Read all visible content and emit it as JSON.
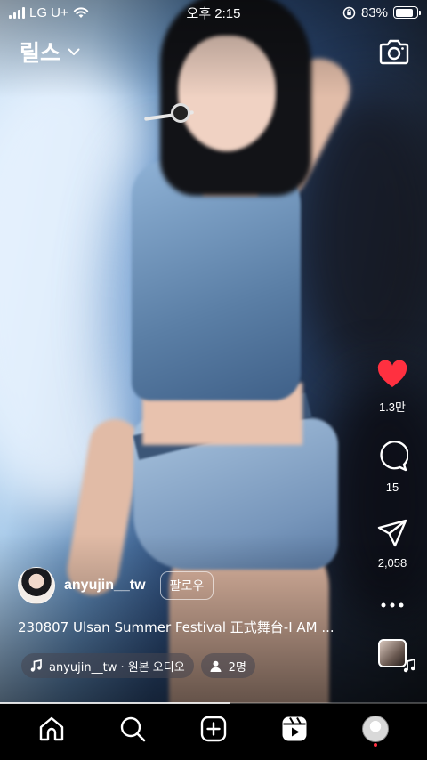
{
  "status_bar": {
    "carrier": "LG U+",
    "time": "오후 2:15",
    "battery_percent": "83%",
    "battery_level": 0.83
  },
  "header": {
    "title": "릴스",
    "dropdown_icon": "chevron-down-icon",
    "camera_icon": "camera-icon"
  },
  "actions": {
    "likes": "1.3만",
    "comments": "15",
    "shares": "2,058",
    "liked": true,
    "like_color": "#ff3040"
  },
  "post": {
    "username": "anyujin__tw",
    "follow_label": "팔로우",
    "caption": "230807 Ulsan Summer Festival 正式舞台-I AM ...",
    "audio": "anyujin__tw · 원본 오디오",
    "people": "2명"
  },
  "video": {
    "progress": 0.54
  },
  "tabbar": {
    "tabs": [
      "home-icon",
      "search-icon",
      "create-icon",
      "reels-icon",
      "profile-avatar"
    ],
    "notification_dot_color": "#ff3040"
  }
}
